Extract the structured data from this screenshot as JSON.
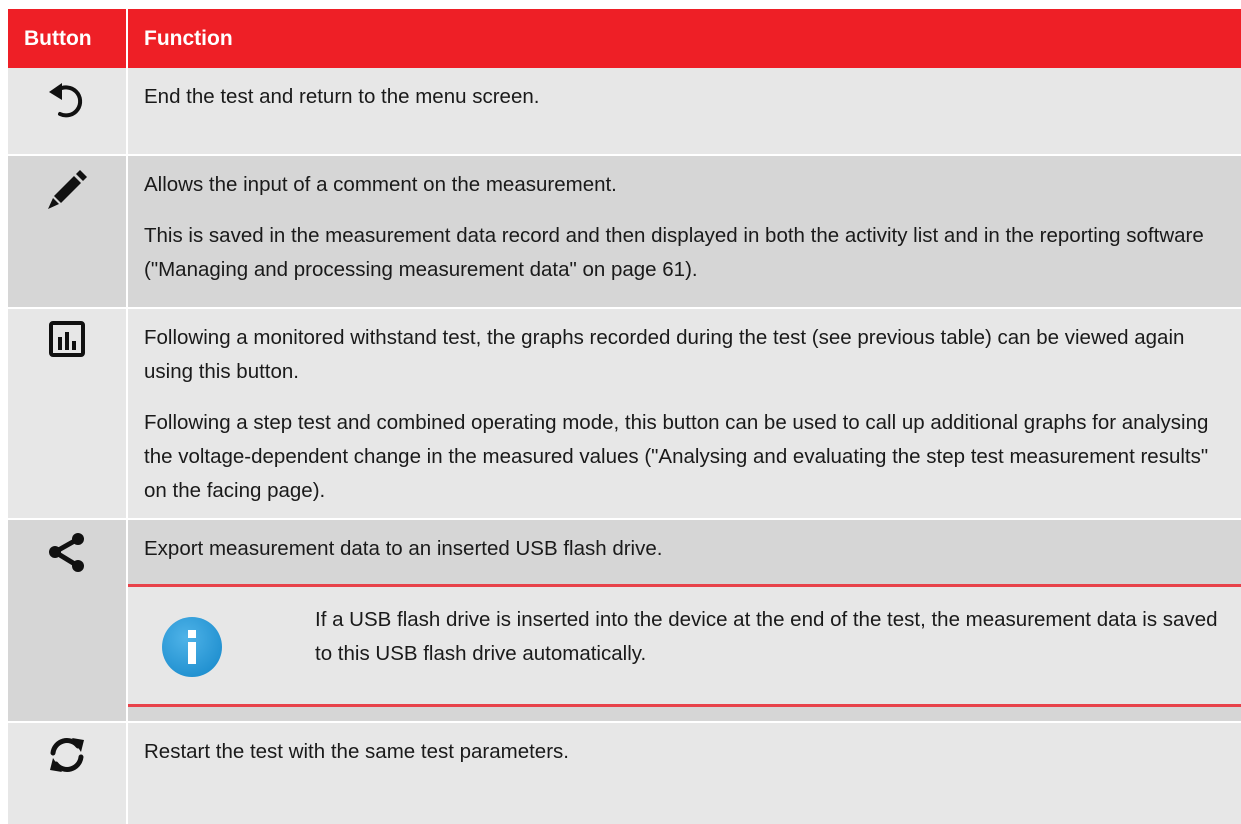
{
  "table": {
    "headers": {
      "button": "Button",
      "function": "Function"
    },
    "rows": [
      {
        "icon": "undo-icon",
        "paragraphs": [
          "End the test and return to the menu screen."
        ]
      },
      {
        "icon": "pencil-icon",
        "paragraphs": [
          "Allows the input of a comment on the measurement.",
          "This is saved in the measurement data record and then displayed in both the activity list and in the reporting software (\"Managing and processing measurement data\" on page 61)."
        ]
      },
      {
        "icon": "bar-chart-icon",
        "paragraphs": [
          "Following a monitored withstand test, the graphs recorded during the test (see previous table) can be viewed again using this button.",
          "Following a step test and combined operating mode, this button can be used to call up additional graphs for analysing the voltage-dependent change in the measured values (\"Analysing and evaluating the step test measurement results\" on the facing page)."
        ]
      },
      {
        "icon": "share-icon",
        "paragraphs": [
          "Export measurement data to an inserted USB flash drive."
        ],
        "note": {
          "icon": "info-icon",
          "text": "If a USB flash drive is inserted into the device at the end of the test, the measurement data is saved to this USB flash drive automatically."
        }
      },
      {
        "icon": "restart-icon",
        "paragraphs": [
          "Restart the test with the same test parameters."
        ]
      }
    ]
  },
  "colors": {
    "header_bg": "#ee1f26",
    "row_light": "#e7e7e7",
    "row_dark": "#d6d6d6",
    "note_border": "#e8424a",
    "info_icon": "#1f8fcf"
  }
}
